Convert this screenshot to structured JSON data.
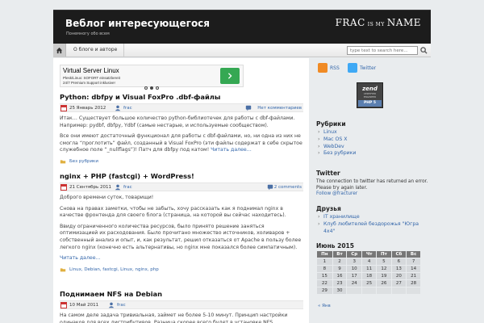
{
  "header": {
    "title": "Веблог интересующегося",
    "description": "Понемногу обо всем",
    "logo": {
      "part1": "FRAC",
      "part2": "IS MY",
      "part3": "NAME"
    }
  },
  "nav": {
    "about": "О блоге и авторе",
    "search_placeholder": "type text to search here..."
  },
  "ad": {
    "title": "Virtual Server Linux",
    "line1": "Plesk (Free) + Parallels Plesk Panel + SOFORT einsatzbereit",
    "line1_short": "Plesk/Linux: SOFORT einsatzbereit",
    "line2": "24/7 Premium Support inklusive!",
    "url": "ionos.de"
  },
  "posts": [
    {
      "title": "Python: dbfpy и Visual FoxPro .dbf-файлы",
      "date": "25 Январь 2012",
      "author": "frac",
      "comments": "Нет комментариев",
      "p1": "Итак… Существует большое количество python-библиотечек для работы с dbf-файлами. Например: pydbf, dbfpy, Ydbf (самые нестарые, и используемые сообществом).",
      "p2": "Все они имеют достаточный функционал для работы с dbf-файлами, но, ни одна из них не смогла “проглотить” файл, созданный в Visual FoxPro (эти файлы содержат в себе  скрытое служебное поле “_nullflags”)!  Патч для dbfpy под катом!",
      "more": "Читать далее…",
      "tags": "Без рубрики"
    },
    {
      "title": "nginx + PHP (fastcgi) + WordPress!",
      "date": "21 Сентябрь 2011",
      "author": "frac",
      "comments": "2 comments",
      "p1": "Доброго времени суток, товарищи!",
      "p2": "Снова на правах заметки, чтобы не забыть, хочу рассказать как я поднимал  nginx в качестве фронтенда для своего блога (страница, на которой вы сейчас находитесь).",
      "p3": "Ввиду ограниченного количества ресурсов, было принято решение заняться оптимизацией их расходования. Было прочитано множество источников, холиваров + собственный анализ и опыт, и, как результат, решил отказаться от Apache в пользу более легкого nginx (конечно есть альтернативы, но nginx мне показался более симпатичным).",
      "more": "Читать далее…",
      "tags": "Linux, Debian, fastcgi, Linux, nginx, php"
    },
    {
      "title": "Поднимаем NFS на Debian",
      "date": "10 Май 2011",
      "author": "frac",
      "comments": "Нет комментариев",
      "p1": "На самом деле задача тривиальная, займет не более 5-10 минут. Принцип настройки одинаков для всех дистрибутивов. Разница скорее всего будет в установке NFS"
    }
  ],
  "sidebar": {
    "rss": "RSS",
    "twitter": "Twitter",
    "zend": {
      "logo": "zend",
      "text": "CERTIFIED ENGINEER",
      "php": "PHP 5"
    },
    "rubrics_title": "Рубрики",
    "rubrics": [
      "Linux",
      "Mac OS X",
      "WebDev",
      "Без рубрики"
    ],
    "twitter_title": "Twitter",
    "twitter_error": "The connection to twitter has returned an error. Please try again later.",
    "twitter_follow": "Follow @fracturer",
    "friends_title": "Друзья",
    "friends": [
      "IT хранилище",
      "Клуб любителей бездорожья \"Югра 4x4\""
    ],
    "calendar_title": "Июнь 2015",
    "calendar_days": [
      "Пн",
      "Вт",
      "Ср",
      "Чт",
      "Пт",
      "Сб",
      "Вс"
    ],
    "calendar_rows": [
      [
        "1",
        "2",
        "3",
        "4",
        "5",
        "6",
        "7"
      ],
      [
        "8",
        "9",
        "10",
        "11",
        "12",
        "13",
        "14"
      ],
      [
        "15",
        "16",
        "17",
        "18",
        "19",
        "20",
        "21"
      ],
      [
        "22",
        "23",
        "24",
        "25",
        "26",
        "27",
        "28"
      ],
      [
        "29",
        "30",
        "",
        "",
        "",
        "",
        ""
      ]
    ],
    "calendar_prev": "« Янв"
  }
}
